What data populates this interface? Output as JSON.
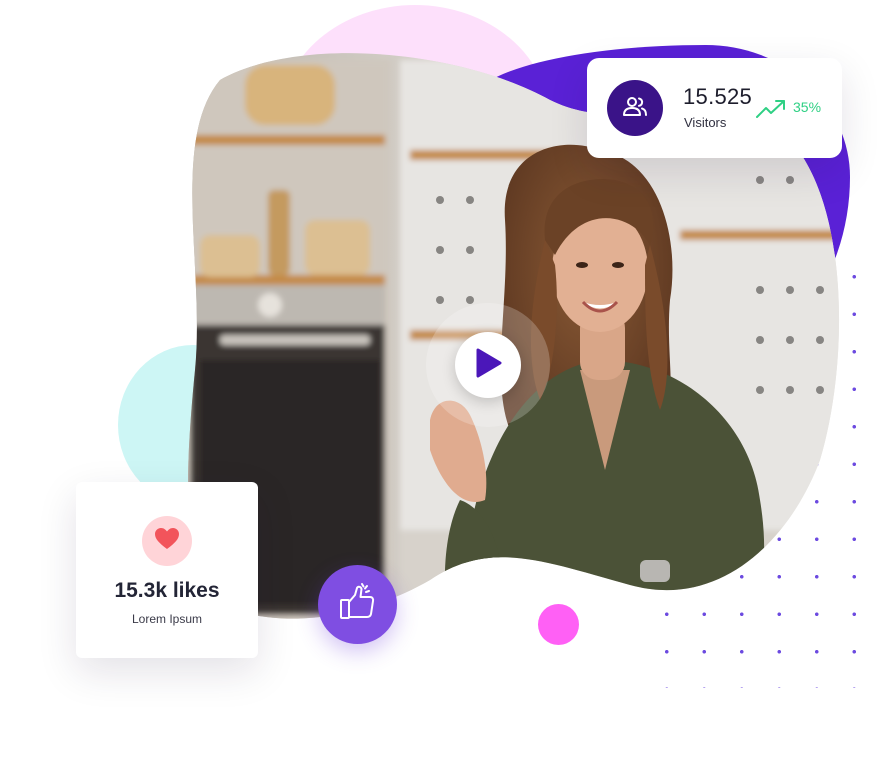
{
  "visitors_card": {
    "count": "15.525",
    "label": "Visitors",
    "trend_percent": "35%",
    "trend_color": "#2fd084",
    "icon": "users-icon"
  },
  "likes_card": {
    "count": "15.3k likes",
    "subtitle": "Lorem Ipsum",
    "icon": "heart-icon",
    "heart_color": "#f2545b"
  },
  "video": {
    "play_icon": "play-icon",
    "accent_color": "#4b17b9"
  },
  "badges": {
    "thumbs_icon": "thumbs-up-icon",
    "thumbs_bg": "#7f4ee2"
  },
  "colors": {
    "purple_blob": "#5a21d6",
    "pink_blob": "#fde0fb",
    "cyan_blob": "#cdf6f5",
    "magenta_dot": "#ff60f5",
    "dot_grid": "#6c4ae0"
  }
}
